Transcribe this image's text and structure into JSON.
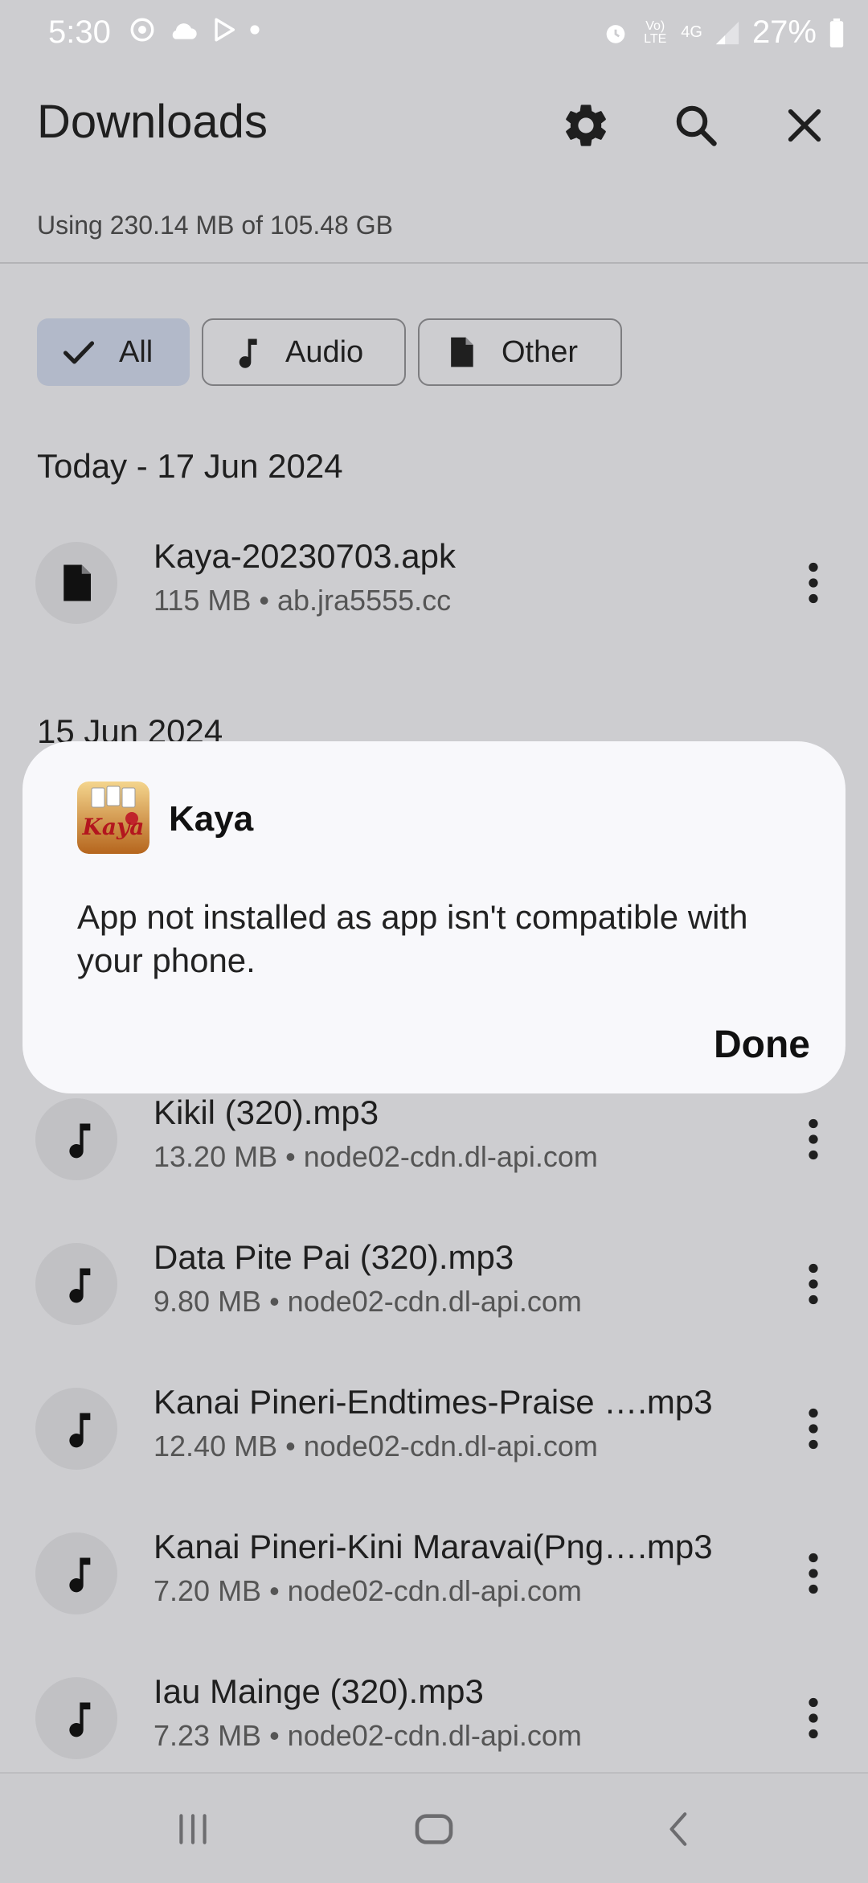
{
  "status_bar": {
    "time": "5:30",
    "battery": "27%",
    "icons": [
      "sync-icon",
      "cloud-icon",
      "play-store-icon",
      "dot-icon",
      "alarm-icon",
      "volte-icon",
      "4g-icon",
      "signal-icon",
      "battery-icon"
    ],
    "volte_label": "Vo) LTE",
    "network_label": "4G"
  },
  "app_bar": {
    "title": "Downloads",
    "actions": [
      "settings-icon",
      "search-icon",
      "close-icon"
    ]
  },
  "storage": {
    "text": "Using 230.14 MB of 105.48 GB"
  },
  "filters": [
    {
      "label": "All",
      "icon": "check-icon",
      "selected": true
    },
    {
      "label": "Audio",
      "icon": "music-note-icon",
      "selected": false
    },
    {
      "label": "Other",
      "icon": "file-icon",
      "selected": false
    }
  ],
  "sections": [
    {
      "header": "Today - 17 Jun 2024",
      "items": [
        {
          "title": "Kaya-20230703.apk",
          "subtitle": "115 MB • ab.jra5555.cc",
          "icon": "file-icon"
        }
      ]
    },
    {
      "header": "15 Jun 2024",
      "items": [
        {
          "title": "Kikil (320).mp3",
          "subtitle": "13.20 MB • node02-cdn.dl-api.com",
          "icon": "music-note-icon"
        },
        {
          "title": "Data Pite Pai (320).mp3",
          "subtitle": "9.80 MB • node02-cdn.dl-api.com",
          "icon": "music-note-icon"
        },
        {
          "title": "Kanai Pineri-Endtimes-Praise ….mp3",
          "subtitle": "12.40 MB • node02-cdn.dl-api.com",
          "icon": "music-note-icon"
        },
        {
          "title": "Kanai Pineri-Kini Maravai(Png….mp3",
          "subtitle": "7.20 MB • node02-cdn.dl-api.com",
          "icon": "music-note-icon"
        },
        {
          "title": "Iau Mainge (320).mp3",
          "subtitle": "7.23 MB • node02-cdn.dl-api.com",
          "icon": "music-note-icon"
        }
      ]
    }
  ],
  "dialog": {
    "app_name": "Kaya",
    "app_icon_text": "Kaya",
    "message": "App not installed as app isn't compatible with your phone.",
    "button": "Done"
  },
  "nav_bar": {
    "buttons": [
      "recents-icon",
      "home-icon",
      "back-icon"
    ]
  },
  "colors": {
    "scrim_background": "#cdcdd0",
    "dialog_background": "#f8f8fb",
    "selected_chip": "#b2b9c9"
  }
}
